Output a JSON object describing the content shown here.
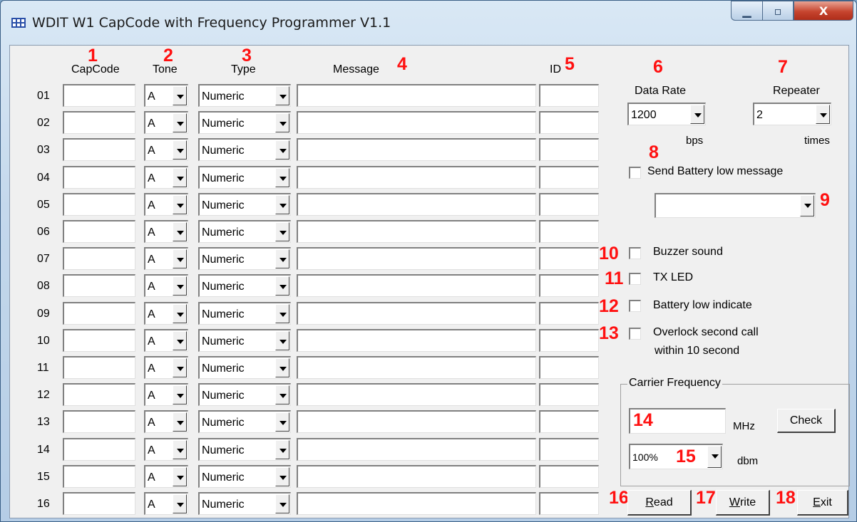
{
  "window": {
    "title": "WDIT W1 CapCode with Frequency Programmer V1.1",
    "min_glyph": "▁",
    "max_glyph": "▫",
    "close_glyph": "X"
  },
  "headers": {
    "capcode": "CapCode",
    "tone": "Tone",
    "type": "Type",
    "message": "Message",
    "id": "ID"
  },
  "callouts": [
    "1",
    "2",
    "3",
    "4",
    "5",
    "6",
    "7",
    "8",
    "9",
    "10",
    "11",
    "12",
    "13",
    "14",
    "15",
    "16",
    "17",
    "18"
  ],
  "rows": [
    {
      "num": "01",
      "tone": "A",
      "type": "Numeric"
    },
    {
      "num": "02",
      "tone": "A",
      "type": "Numeric"
    },
    {
      "num": "03",
      "tone": "A",
      "type": "Numeric"
    },
    {
      "num": "04",
      "tone": "A",
      "type": "Numeric"
    },
    {
      "num": "05",
      "tone": "A",
      "type": "Numeric"
    },
    {
      "num": "06",
      "tone": "A",
      "type": "Numeric"
    },
    {
      "num": "07",
      "tone": "A",
      "type": "Numeric"
    },
    {
      "num": "08",
      "tone": "A",
      "type": "Numeric"
    },
    {
      "num": "09",
      "tone": "A",
      "type": "Numeric"
    },
    {
      "num": "10",
      "tone": "A",
      "type": "Numeric"
    },
    {
      "num": "11",
      "tone": "A",
      "type": "Numeric"
    },
    {
      "num": "12",
      "tone": "A",
      "type": "Numeric"
    },
    {
      "num": "13",
      "tone": "A",
      "type": "Numeric"
    },
    {
      "num": "14",
      "tone": "A",
      "type": "Numeric"
    },
    {
      "num": "15",
      "tone": "A",
      "type": "Numeric"
    },
    {
      "num": "16",
      "tone": "A",
      "type": "Numeric"
    }
  ],
  "settings": {
    "data_rate_label": "Data Rate",
    "data_rate_value": "1200",
    "data_rate_unit": "bps",
    "repeater_label": "Repeater",
    "repeater_value": "2",
    "repeater_unit": "times",
    "battery_msg_label": "Send Battery low message",
    "battery_msg_value": "",
    "buzzer_label": "Buzzer sound",
    "txled_label": "TX LED",
    "battery_indicate_label": "Battery low indicate",
    "overlock_label_1": "Overlock second call",
    "overlock_label_2": "within 10 second"
  },
  "carrier": {
    "group_title": "Carrier Frequency",
    "freq_value": "",
    "freq_unit": "MHz",
    "check_label": "Check",
    "power_value": "100%",
    "power_unit": "dbm"
  },
  "buttons": {
    "read_mnemonic": "R",
    "read_rest": "ead",
    "write_mnemonic": "W",
    "write_rest": "rite",
    "exit_mnemonic": "E",
    "exit_rest": "xit"
  },
  "colors": {
    "callout": "#ff1010",
    "client_bg": "#f0f0f0",
    "close_button": "#c6452f"
  }
}
